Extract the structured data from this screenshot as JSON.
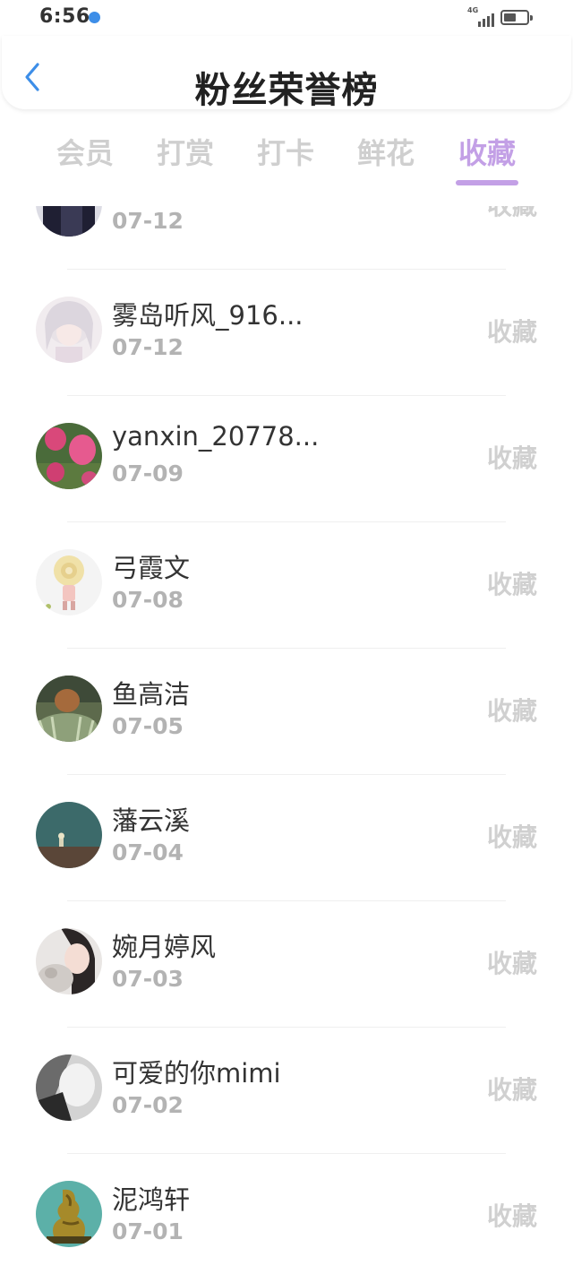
{
  "status_bar": {
    "time": "6:56",
    "network": "4G",
    "signal_level": 0.8,
    "battery_level": 0.55
  },
  "header": {
    "title": "粉丝荣誉榜"
  },
  "tabs": [
    {
      "label": "会员",
      "active": false
    },
    {
      "label": "打赏",
      "active": false
    },
    {
      "label": "打卡",
      "active": false
    },
    {
      "label": "鲜花",
      "active": false
    },
    {
      "label": "收藏",
      "active": true
    }
  ],
  "accent_color": "#c3a0e6",
  "list": {
    "items": [
      {
        "name": "",
        "date": "07-12",
        "action": "收藏",
        "avatar": "dark-figure"
      },
      {
        "name": "雾岛听风_916...",
        "date": "07-12",
        "action": "收藏",
        "avatar": "anime-girl"
      },
      {
        "name": "yanxin_20778...",
        "date": "07-09",
        "action": "收藏",
        "avatar": "pink-tulips"
      },
      {
        "name": "弓霞文",
        "date": "07-08",
        "action": "收藏",
        "avatar": "cartoon-doll"
      },
      {
        "name": "鱼高洁",
        "date": "07-05",
        "action": "收藏",
        "avatar": "cat-on-plant"
      },
      {
        "name": "藩云溪",
        "date": "07-04",
        "action": "收藏",
        "avatar": "teal-wall"
      },
      {
        "name": "婉月婷风",
        "date": "07-03",
        "action": "收藏",
        "avatar": "girl-with-cat"
      },
      {
        "name": "可爱的你mimi",
        "date": "07-02",
        "action": "收藏",
        "avatar": "bw-portrait"
      },
      {
        "name": "泥鸿轩",
        "date": "07-01",
        "action": "收藏",
        "avatar": "jade-dragon"
      }
    ]
  }
}
